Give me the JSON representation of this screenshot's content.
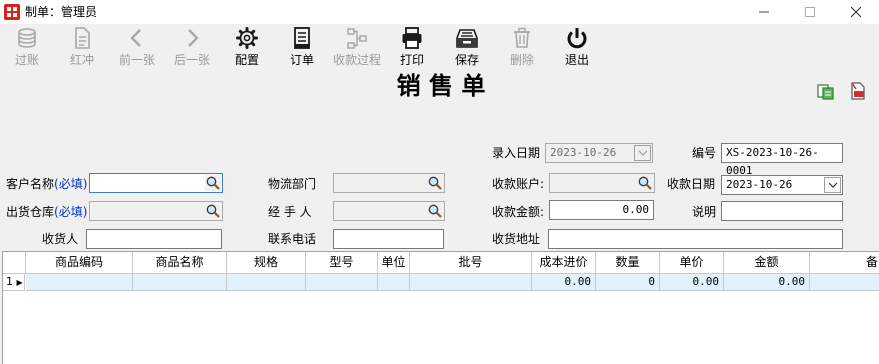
{
  "window": {
    "title": "制单：管理员",
    "icon": "app-grid-icon",
    "brand_color": "#d9221c"
  },
  "toolbar": {
    "buttons": [
      {
        "label": "过账",
        "icon": "coins-icon",
        "enabled": false
      },
      {
        "label": "红冲",
        "icon": "document-icon",
        "enabled": false
      },
      {
        "label": "前一张",
        "icon": "chevron-left-icon",
        "enabled": false
      },
      {
        "label": "后一张",
        "icon": "chevron-right-icon",
        "enabled": false
      },
      {
        "label": "配置",
        "icon": "gear-icon",
        "enabled": true
      },
      {
        "label": "订单",
        "icon": "notebook-icon",
        "enabled": true
      },
      {
        "label": "收款过程",
        "icon": "flow-icon",
        "enabled": false
      },
      {
        "label": "打印",
        "icon": "printer-icon",
        "enabled": true
      },
      {
        "label": "保存",
        "icon": "save-tray-icon",
        "enabled": true
      },
      {
        "label": "删除",
        "icon": "trash-icon",
        "enabled": false
      },
      {
        "label": "退出",
        "icon": "power-icon",
        "enabled": true
      }
    ]
  },
  "document": {
    "title": "销 售 单"
  },
  "form": {
    "entry_date_label": "录入日期",
    "entry_date_value": "2023-10-26",
    "number_label": "编号",
    "number_value": "XS-2023-10-26-0001",
    "customer_label": "客户名称",
    "required_mark": "(必填)",
    "customer_value": "",
    "logistics_label": "物流部门",
    "logistics_value": "",
    "receipt_account_label": "收款账户:",
    "receipt_account_value": "",
    "receipt_date_label": "收款日期",
    "receipt_date_value": "2023-10-26",
    "warehouse_label": "出货仓库",
    "warehouse_value": "",
    "handler_label": "经 手 人",
    "handler_value": "",
    "receipt_amount_label": "收款金额:",
    "receipt_amount_value": "0.00",
    "note_label": "说明",
    "note_value": "",
    "receiver_label": "收货人",
    "receiver_value": "",
    "phone_label": "联系电话",
    "phone_value": "",
    "address_label": "收货地址",
    "address_value": ""
  },
  "grid": {
    "columns": [
      "商品编码",
      "商品名称",
      "规格",
      "型号",
      "单位",
      "批号",
      "成本进价",
      "数量",
      "单价",
      "金额",
      "备"
    ],
    "rows": [
      {
        "row_no": "1",
        "marker": "▶",
        "cells": [
          "",
          "",
          "",
          "",
          "",
          "",
          "0.00",
          "0",
          "0.00",
          "0.00",
          ""
        ]
      }
    ],
    "selected_row_color": "#e3f1fb"
  }
}
